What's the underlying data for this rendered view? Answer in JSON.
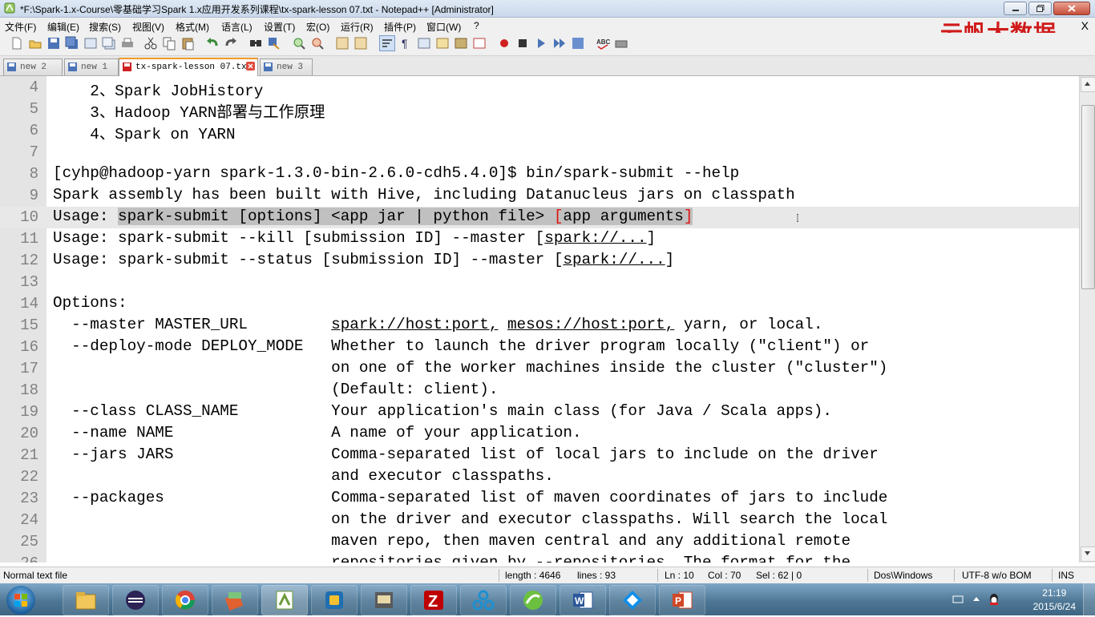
{
  "window": {
    "title": "*F:\\Spark-1.x-Course\\零基础学习Spark 1.x应用开发系列课程\\tx-spark-lesson 07.txt - Notepad++ [Administrator]"
  },
  "menu": [
    "文件(F)",
    "编辑(E)",
    "搜索(S)",
    "视图(V)",
    "格式(M)",
    "语言(L)",
    "设置(T)",
    "宏(O)",
    "运行(R)",
    "插件(P)",
    "窗口(W)",
    "?"
  ],
  "menu_close": "X",
  "watermark": "云帆大数据",
  "tabs": [
    {
      "label": "new  2",
      "active": false
    },
    {
      "label": "new  1",
      "active": false
    },
    {
      "label": "tx-spark-lesson 07.txt",
      "active": true
    },
    {
      "label": "new  3",
      "active": false
    }
  ],
  "editor": {
    "lines": [
      {
        "n": "4",
        "text": "    2、Spark JobHistory"
      },
      {
        "n": "5",
        "text": "    3、Hadoop YARN部署与工作原理"
      },
      {
        "n": "6",
        "text": "    4、Spark on YARN"
      },
      {
        "n": "7",
        "text": ""
      },
      {
        "n": "8",
        "text": "[cyhp@hadoop-yarn spark-1.3.0-bin-2.6.0-cdh5.4.0]$ bin/spark-submit --help"
      },
      {
        "n": "9",
        "text": "Spark assembly has been built with Hive, including Datanucleus jars on classpath"
      },
      {
        "n": "10",
        "prefix": "Usage: ",
        "selected": "spark-submit [options] <app jar | python file> ",
        "bracket_open": "[",
        "bracket_text": "app arguments",
        "bracket_close": "]"
      },
      {
        "n": "11",
        "before": "Usage: spark-submit --kill [submission ID] --master [",
        "link": "spark://...",
        "after": "]"
      },
      {
        "n": "12",
        "before": "Usage: spark-submit --status [submission ID] --master [",
        "link": "spark://...",
        "after": "]"
      },
      {
        "n": "13",
        "text": ""
      },
      {
        "n": "14",
        "text": "Options:"
      },
      {
        "n": "15",
        "before": "  --master MASTER_URL         ",
        "link": "spark://host:port,",
        "mid": " ",
        "link2": "mesos://host:port,",
        "after": " yarn, or local."
      },
      {
        "n": "16",
        "text": "  --deploy-mode DEPLOY_MODE   Whether to launch the driver program locally (\"client\") or"
      },
      {
        "n": "17",
        "text": "                              on one of the worker machines inside the cluster (\"cluster\")"
      },
      {
        "n": "18",
        "text": "                              (Default: client)."
      },
      {
        "n": "19",
        "text": "  --class CLASS_NAME          Your application's main class (for Java / Scala apps)."
      },
      {
        "n": "20",
        "text": "  --name NAME                 A name of your application."
      },
      {
        "n": "21",
        "text": "  --jars JARS                 Comma-separated list of local jars to include on the driver"
      },
      {
        "n": "22",
        "text": "                              and executor classpaths."
      },
      {
        "n": "23",
        "text": "  --packages                  Comma-separated list of maven coordinates of jars to include"
      },
      {
        "n": "24",
        "text": "                              on the driver and executor classpaths. Will search the local"
      },
      {
        "n": "25",
        "text": "                              maven repo, then maven central and any additional remote"
      },
      {
        "n": "26",
        "text": "                              repositories given by --repositories. The format for the"
      }
    ],
    "current_line": "10"
  },
  "status": {
    "file_type": "Normal text file",
    "length": "length : 4646",
    "lines": "lines : 93",
    "ln": "Ln : 10",
    "col": "Col : 70",
    "sel": "Sel : 62 | 0",
    "eol": "Dos\\Windows",
    "encoding": "UTF-8 w/o BOM",
    "mode": "INS"
  },
  "taskbar": {
    "apps": [
      "explorer-icon",
      "eclipse-icon",
      "chrome-icon",
      "editor-icon",
      "notepadpp-icon",
      "virtualbox-icon",
      "vm-console-icon",
      "filezilla-icon",
      "network-icon",
      "green-app-icon",
      "word-icon",
      "teamviewer-icon",
      "powerpoint-icon"
    ],
    "time": "21:19",
    "date": "2015/6/24"
  },
  "colors": {
    "accent_tab": "#f39a2a",
    "watermark": "#d01a1a",
    "bracket": "#e01010",
    "selection": "#c0c0c0"
  }
}
